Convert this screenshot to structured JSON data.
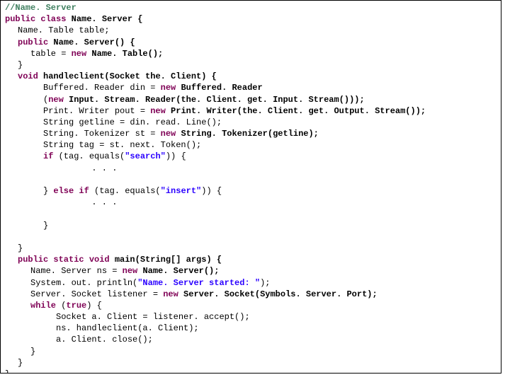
{
  "code": {
    "l1": "//Name. Server",
    "l2a": "public class ",
    "l2b": "Name. Server {",
    "l3": "Name. Table table;",
    "l4a": "public ",
    "l4b": "Name. Server() {",
    "l5a": "table = ",
    "l5b": "new ",
    "l5c": "Name. Table();",
    "l6": "}",
    "l7a": "void ",
    "l7b": "handleclient(Socket the. Client) {",
    "l8a": "Buffered. Reader din = ",
    "l8b": "new ",
    "l8c": "Buffered. Reader",
    "l9a": "(",
    "l9b": "new ",
    "l9c": "Input. Stream. Reader(the. Client. get. Input. Stream()));",
    "l10a": "Print. Writer pout = ",
    "l10b": "new ",
    "l10c": "Print. Writer(the. Client. get. Output. Stream());",
    "l11": "String getline = din. read. Line();",
    "l12a": "String. Tokenizer st = ",
    "l12b": "new ",
    "l12c": "String. Tokenizer(getline);",
    "l13": "String tag = st. next. Token();",
    "l14a": "if ",
    "l14b": "(tag. equals(",
    "l14c": "\"search\"",
    "l14d": ")) {",
    "l15": ". . .",
    "l16a": "} ",
    "l16b": "else if ",
    "l16c": "(tag. equals(",
    "l16d": "\"insert\"",
    "l16e": ")) {",
    "l17": ". . .",
    "l18": "}",
    "l19": "}",
    "l20a": "public static void ",
    "l20b": "main(String[] args) {",
    "l21a": "Name. Server ns = ",
    "l21b": "new ",
    "l21c": "Name. Server();",
    "l22a": "System. out. println(",
    "l22b": "\"Name. Server started: \"",
    "l22c": ");",
    "l23a": "Server. Socket listener = ",
    "l23b": "new ",
    "l23c": "Server. Socket(Symbols. Server. Port);",
    "l24a": "while ",
    "l24b": "(",
    "l24c": "true",
    "l24d": ") {",
    "l25": "Socket a. Client = listener. accept();",
    "l26": "ns. handleclient(a. Client);",
    "l27": "a. Client. close();",
    "l28": "}",
    "l29": "}",
    "l30": "}"
  }
}
